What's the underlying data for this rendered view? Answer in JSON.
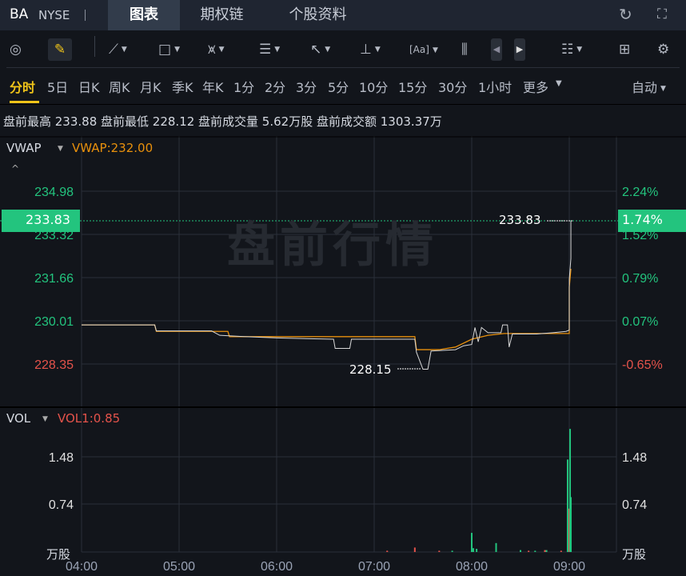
{
  "header": {
    "symbol": "BA",
    "exchange": "NYSE",
    "tabs": [
      {
        "label": "图表",
        "active": true
      },
      {
        "label": "期权链"
      },
      {
        "label": "个股资料"
      }
    ],
    "icons": [
      "refresh-icon",
      "fullscreen-icon"
    ]
  },
  "toolbar": {
    "icons": [
      "gauge-icon",
      "pencil-icon",
      "line-tool-icon",
      "rectangle-tool-icon",
      "pattern-tool-icon",
      "fib-tool-icon",
      "arrow-tool-icon",
      "measure-tool-icon",
      "text-tool-icon",
      "candle-icon",
      "prev-icon",
      "next-icon",
      "list-icon",
      "layout-grid-icon",
      "settings-icon"
    ]
  },
  "timeframes": [
    "分时",
    "5日",
    "日K",
    "周K",
    "月K",
    "季K",
    "年K",
    "1分",
    "2分",
    "3分",
    "5分",
    "10分",
    "15分",
    "30分",
    "1小时",
    "更多"
  ],
  "auto_label": "自动",
  "info": "盘前最高 233.88 盘前最低 228.12 盘前成交量 5.62万股 盘前成交额 1303.37万",
  "price_panel": {
    "indicator": "VWAP",
    "indicator_value": "VWAP:232.00",
    "watermark": "盘前行情",
    "current_price": "233.83",
    "current_pct": "1.74%",
    "high_label": "233.83",
    "low_label": "228.15"
  },
  "vol_panel": {
    "indicator": "VOL",
    "indicator_value": "VOL1:0.85",
    "unit": "万股"
  },
  "colors": {
    "up": "#23c47e",
    "down": "#e5534b",
    "vwap": "#e8900c",
    "price": "#d8d8d8",
    "accent": "#f0c419"
  },
  "chart_data": {
    "type": "line",
    "x_ticks": [
      "04:00",
      "05:00",
      "06:00",
      "07:00",
      "08:00",
      "09:00"
    ],
    "y_ticks_left": [
      "234.98",
      "233.32",
      "231.66",
      "230.01",
      "228.35"
    ],
    "y_ticks_right": [
      "2.24%",
      "1.52%",
      "0.79%",
      "0.07%",
      "-0.65%"
    ],
    "ylim": [
      228.35,
      234.98
    ],
    "price": [
      [
        "04:00",
        229.85
      ],
      [
        "04:45",
        229.85
      ],
      [
        "04:46",
        229.62
      ],
      [
        "05:20",
        229.62
      ],
      [
        "05:25",
        229.45
      ],
      [
        "05:40",
        229.4
      ],
      [
        "06:00",
        229.35
      ],
      [
        "06:35",
        229.3
      ],
      [
        "06:36",
        228.95
      ],
      [
        "06:45",
        228.95
      ],
      [
        "06:46",
        229.3
      ],
      [
        "07:25",
        229.3
      ],
      [
        "07:26",
        228.8
      ],
      [
        "07:30",
        228.15
      ],
      [
        "07:33",
        228.15
      ],
      [
        "07:35",
        228.85
      ],
      [
        "07:50",
        228.9
      ],
      [
        "07:55",
        229.05
      ],
      [
        "08:00",
        229.1
      ],
      [
        "08:02",
        229.75
      ],
      [
        "08:04",
        229.2
      ],
      [
        "08:06",
        229.75
      ],
      [
        "08:10",
        229.55
      ],
      [
        "08:18",
        229.55
      ],
      [
        "08:19",
        229.85
      ],
      [
        "08:22",
        229.85
      ],
      [
        "08:23",
        229.0
      ],
      [
        "08:25",
        229.5
      ],
      [
        "08:40",
        229.5
      ],
      [
        "08:50",
        229.55
      ],
      [
        "08:58",
        229.6
      ],
      [
        "09:00",
        229.65
      ],
      [
        "09:00",
        231.6
      ],
      [
        "09:01",
        232.4
      ],
      [
        "09:01",
        233.83
      ]
    ],
    "vwap": [
      [
        "04:00",
        229.85
      ],
      [
        "04:45",
        229.85
      ],
      [
        "04:46",
        229.6
      ],
      [
        "05:30",
        229.6
      ],
      [
        "05:31",
        229.4
      ],
      [
        "07:25",
        229.4
      ],
      [
        "07:26",
        228.9
      ],
      [
        "07:40",
        228.9
      ],
      [
        "07:50",
        229.0
      ],
      [
        "08:00",
        229.3
      ],
      [
        "08:10",
        229.45
      ],
      [
        "08:20",
        229.52
      ],
      [
        "09:00",
        229.52
      ],
      [
        "09:00",
        231.3
      ],
      [
        "09:01",
        232.0
      ]
    ],
    "volume": {
      "ylim": [
        0,
        2.22
      ],
      "y_ticks": [
        "1.48",
        "0.74"
      ],
      "bars": [
        [
          "07:08",
          0.02,
          "down"
        ],
        [
          "07:25",
          0.07,
          "down"
        ],
        [
          "07:40",
          0.02,
          "down"
        ],
        [
          "07:48",
          0.02,
          "up"
        ],
        [
          "08:00",
          0.3,
          "up"
        ],
        [
          "08:01",
          0.06,
          "up"
        ],
        [
          "08:03",
          0.05,
          "up"
        ],
        [
          "08:15",
          0.14,
          "up"
        ],
        [
          "08:30",
          0.03,
          "up"
        ],
        [
          "08:35",
          0.02,
          "down"
        ],
        [
          "08:39",
          0.02,
          "up"
        ],
        [
          "08:45",
          0.03,
          "down"
        ],
        [
          "08:46",
          0.03,
          "up"
        ],
        [
          "08:55",
          0.02,
          "down"
        ],
        [
          "08:59",
          1.45,
          "up"
        ],
        [
          "09:00",
          0.68,
          "down"
        ],
        [
          "09:00.5",
          1.93,
          "up"
        ],
        [
          "09:01",
          0.86,
          "up"
        ]
      ]
    }
  }
}
